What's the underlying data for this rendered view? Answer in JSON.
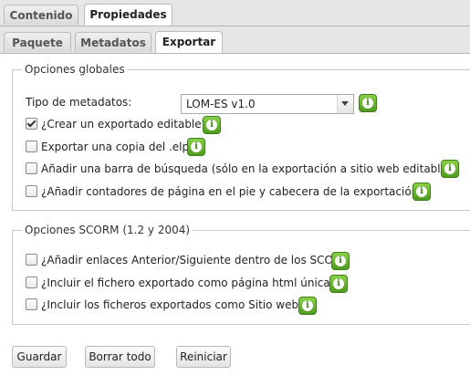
{
  "tabs_top": [
    {
      "label": "Contenido"
    },
    {
      "label": "Propiedades"
    }
  ],
  "tabs_sub": [
    {
      "label": "Paquete"
    },
    {
      "label": "Metadatos"
    },
    {
      "label": "Exportar"
    }
  ],
  "global_options": {
    "legend": "Opciones globales",
    "metadata_label": "Tipo de metadatos:",
    "metadata_value": "LOM-ES v1.0",
    "options": [
      {
        "label": "¿Crear un exportado editable?",
        "checked": true
      },
      {
        "label": "Exportar una copia del .elp",
        "checked": false
      },
      {
        "label": "Añadir una barra de búsqueda (sólo en la exportación a sitio web editable)",
        "checked": false
      },
      {
        "label": "¿Añadir contadores de página en el pie y cabecera de la exportación?",
        "checked": false
      }
    ]
  },
  "scorm_options": {
    "legend": "Opciones SCORM (1.2 y 2004)",
    "options": [
      {
        "label": "¿Añadir enlaces Anterior/Siguiente dentro de los SCO?",
        "checked": false
      },
      {
        "label": "¿Incluir el fichero exportado como página html única?",
        "checked": false
      },
      {
        "label": "¿Incluir los ficheros exportados como Sitio web?",
        "checked": false
      }
    ]
  },
  "buttons": {
    "save": "Guardar",
    "clear": "Borrar todo",
    "reset": "Reiniciar"
  },
  "icons": {
    "info": "info-icon",
    "dropdown": "chevron-down-icon",
    "check": "checkmark-icon"
  },
  "colors": {
    "info_green": "#5aa82a",
    "tab_bar": "#e6e6e6"
  }
}
